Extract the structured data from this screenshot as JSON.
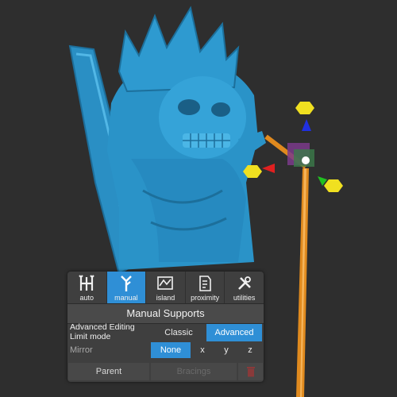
{
  "tabs": [
    {
      "label": "auto",
      "icon": "auto-supports-icon"
    },
    {
      "label": "manual",
      "icon": "manual-supports-icon"
    },
    {
      "label": "island",
      "icon": "island-icon"
    },
    {
      "label": "proximity",
      "icon": "proximity-icon"
    },
    {
      "label": "utilities",
      "icon": "utilities-icon"
    }
  ],
  "active_tab": "manual",
  "panel_title": "Manual Supports",
  "advanced_editing": {
    "label_line1": "Advanced Editing",
    "label_line2": "Limit mode",
    "options": [
      "Classic",
      "Advanced"
    ],
    "selected": "Advanced"
  },
  "mirror": {
    "label": "Mirror",
    "options": [
      "None",
      "x",
      "y",
      "z"
    ],
    "selected": "None"
  },
  "bottom": {
    "parent_label": "Parent",
    "bracings_label": "Bracings",
    "delete_icon": "trash-icon"
  },
  "colors": {
    "accent": "#2f8fd6",
    "model": "#2a93c8",
    "support": "#e08a1e",
    "background": "#2e2e2e"
  }
}
